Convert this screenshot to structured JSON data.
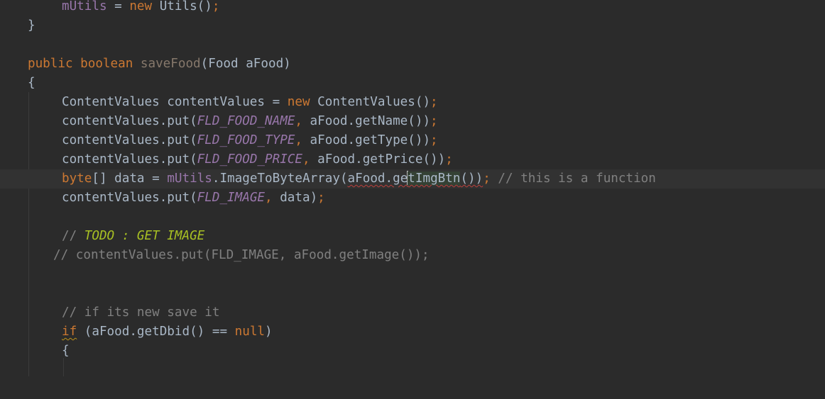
{
  "editor": {
    "lines": {
      "l0": {
        "a": "mUtils",
        "b": " = ",
        "c": "new",
        "d": " Utils()",
        "e": ";"
      },
      "l1": {
        "a": "}"
      },
      "l3": {
        "a": "public",
        "b": " ",
        "c": "boolean",
        "d": " ",
        "e": "saveFood",
        "f": "(Food aFood)"
      },
      "l4": {
        "a": "{"
      },
      "l5": {
        "a": "ContentValues contentValues = ",
        "b": "new",
        "c": " ContentValues()",
        "d": ";"
      },
      "l6": {
        "a": "contentValues.put(",
        "b": "FLD_FOOD_NAME",
        "c": ",",
        "d": " aFood.getName())",
        "e": ";"
      },
      "l7": {
        "a": "contentValues.put(",
        "b": "FLD_FOOD_TYPE",
        "c": ",",
        "d": " aFood.getType())",
        "e": ";"
      },
      "l8": {
        "a": "contentValues.put(",
        "b": "FLD_FOOD_PRICE",
        "c": ",",
        "d": " aFood.getPrice())",
        "e": ";"
      },
      "l9": {
        "a": "byte",
        "b": "[] data = ",
        "c": "mUtils",
        "d": ".ImageToByteArray(",
        "e": "aFood.ge",
        "f": "tImgBtn",
        "g": "())",
        "h": ";",
        "i": " // this is a function"
      },
      "l10": {
        "a": "contentValues.put(",
        "b": "FLD_IMAGE",
        "c": ",",
        "d": " data)",
        "e": ";"
      },
      "l12": {
        "a": "// ",
        "b": "TODO : GET IMAGE"
      },
      "l13": {
        "a": "// contentValues.put(FLD_IMAGE, aFood.getImage());"
      },
      "l16": {
        "a": "// if its new save it"
      },
      "l17": {
        "a": "if",
        "b": " (aFood.getDbid() == ",
        "c": "null",
        "d": ")"
      },
      "l18": {
        "a": "{"
      }
    }
  }
}
